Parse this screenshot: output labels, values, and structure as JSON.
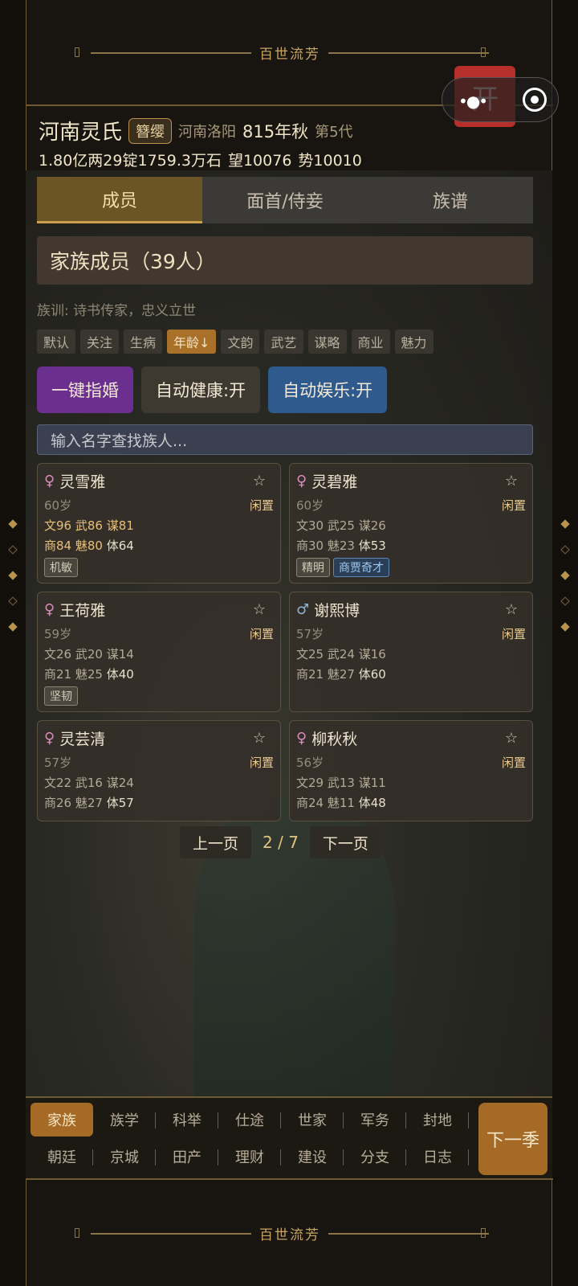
{
  "banner": {
    "title": "百世流芳"
  },
  "capsule": {
    "toggle": "开"
  },
  "header": {
    "clan_name": "河南灵氏",
    "rank": "簪缨",
    "location": "河南洛阳",
    "date": "815年秋",
    "generation": "第5代",
    "wealth": "1.80亿两29锭1759.3万石",
    "prestige": "望10076",
    "power": "势10010"
  },
  "tabs": [
    {
      "label": "成员",
      "active": true
    },
    {
      "label": "面首/侍妾",
      "active": false
    },
    {
      "label": "族谱",
      "active": false
    }
  ],
  "section_title": "家族成员（39人）",
  "motto": "族训: 诗书传家，忠义立世",
  "sort_chips": [
    {
      "label": "默认"
    },
    {
      "label": "关注"
    },
    {
      "label": "生病"
    },
    {
      "label": "年龄↓",
      "active": true
    },
    {
      "label": "文韵"
    },
    {
      "label": "武艺"
    },
    {
      "label": "谋略"
    },
    {
      "label": "商业"
    },
    {
      "label": "魅力"
    }
  ],
  "actions": {
    "marry": "一键指婚",
    "auto_health": "自动健康:开",
    "auto_fun": "自动娱乐:开"
  },
  "search": {
    "placeholder": "输入名字查找族人..."
  },
  "members": [
    {
      "symbol": "♀",
      "name": "灵雪雅",
      "age": "60岁",
      "status": "闲置",
      "star": "☆",
      "line1": [
        "文96",
        "武86",
        "谋81"
      ],
      "line2": [
        "商84",
        "魅80",
        "体64"
      ],
      "tags": [
        "机敏"
      ]
    },
    {
      "symbol": "♀",
      "name": "灵碧雅",
      "age": "60岁",
      "status": "闲置",
      "star": "☆",
      "line1": [
        "文30",
        "武25",
        "谋26"
      ],
      "line2": [
        "商30",
        "魅23",
        "体53"
      ],
      "tags": [
        "精明",
        "商贾奇才"
      ]
    },
    {
      "symbol": "♀",
      "name": "王荷雅",
      "age": "59岁",
      "status": "闲置",
      "star": "☆",
      "line1": [
        "文26",
        "武20",
        "谋14"
      ],
      "line2": [
        "商21",
        "魅25",
        "体40"
      ],
      "tags": [
        "坚韧"
      ]
    },
    {
      "symbol": "♂",
      "name": "谢熙博",
      "age": "57岁",
      "status": "闲置",
      "star": "☆",
      "line1": [
        "文25",
        "武24",
        "谋16"
      ],
      "line2": [
        "商21",
        "魅27",
        "体60"
      ],
      "tags": []
    },
    {
      "symbol": "♀",
      "name": "灵芸清",
      "age": "57岁",
      "status": "闲置",
      "star": "☆",
      "line1": [
        "文22",
        "武16",
        "谋24"
      ],
      "line2": [
        "商26",
        "魅27",
        "体57"
      ],
      "tags": []
    },
    {
      "symbol": "♀",
      "name": "柳秋秋",
      "age": "56岁",
      "status": "闲置",
      "star": "☆",
      "line1": [
        "文29",
        "武13",
        "谋11"
      ],
      "line2": [
        "商24",
        "魅11",
        "体48"
      ],
      "tags": []
    }
  ],
  "pager": {
    "prev": "上一页",
    "page": "2 / 7",
    "next": "下一页"
  },
  "bottom_nav": {
    "row1": [
      "家族",
      "族学",
      "科举",
      "仕途",
      "世家",
      "军务",
      "封地"
    ],
    "row2": [
      "朝廷",
      "京城",
      "田产",
      "理财",
      "建设",
      "分支",
      "日志"
    ],
    "active": "家族",
    "next_season": "下一季"
  },
  "colors": {
    "accent": "#a46a26",
    "purple": "#6a2f8f",
    "blue": "#2f5a8e",
    "gold": "#c9a560"
  }
}
